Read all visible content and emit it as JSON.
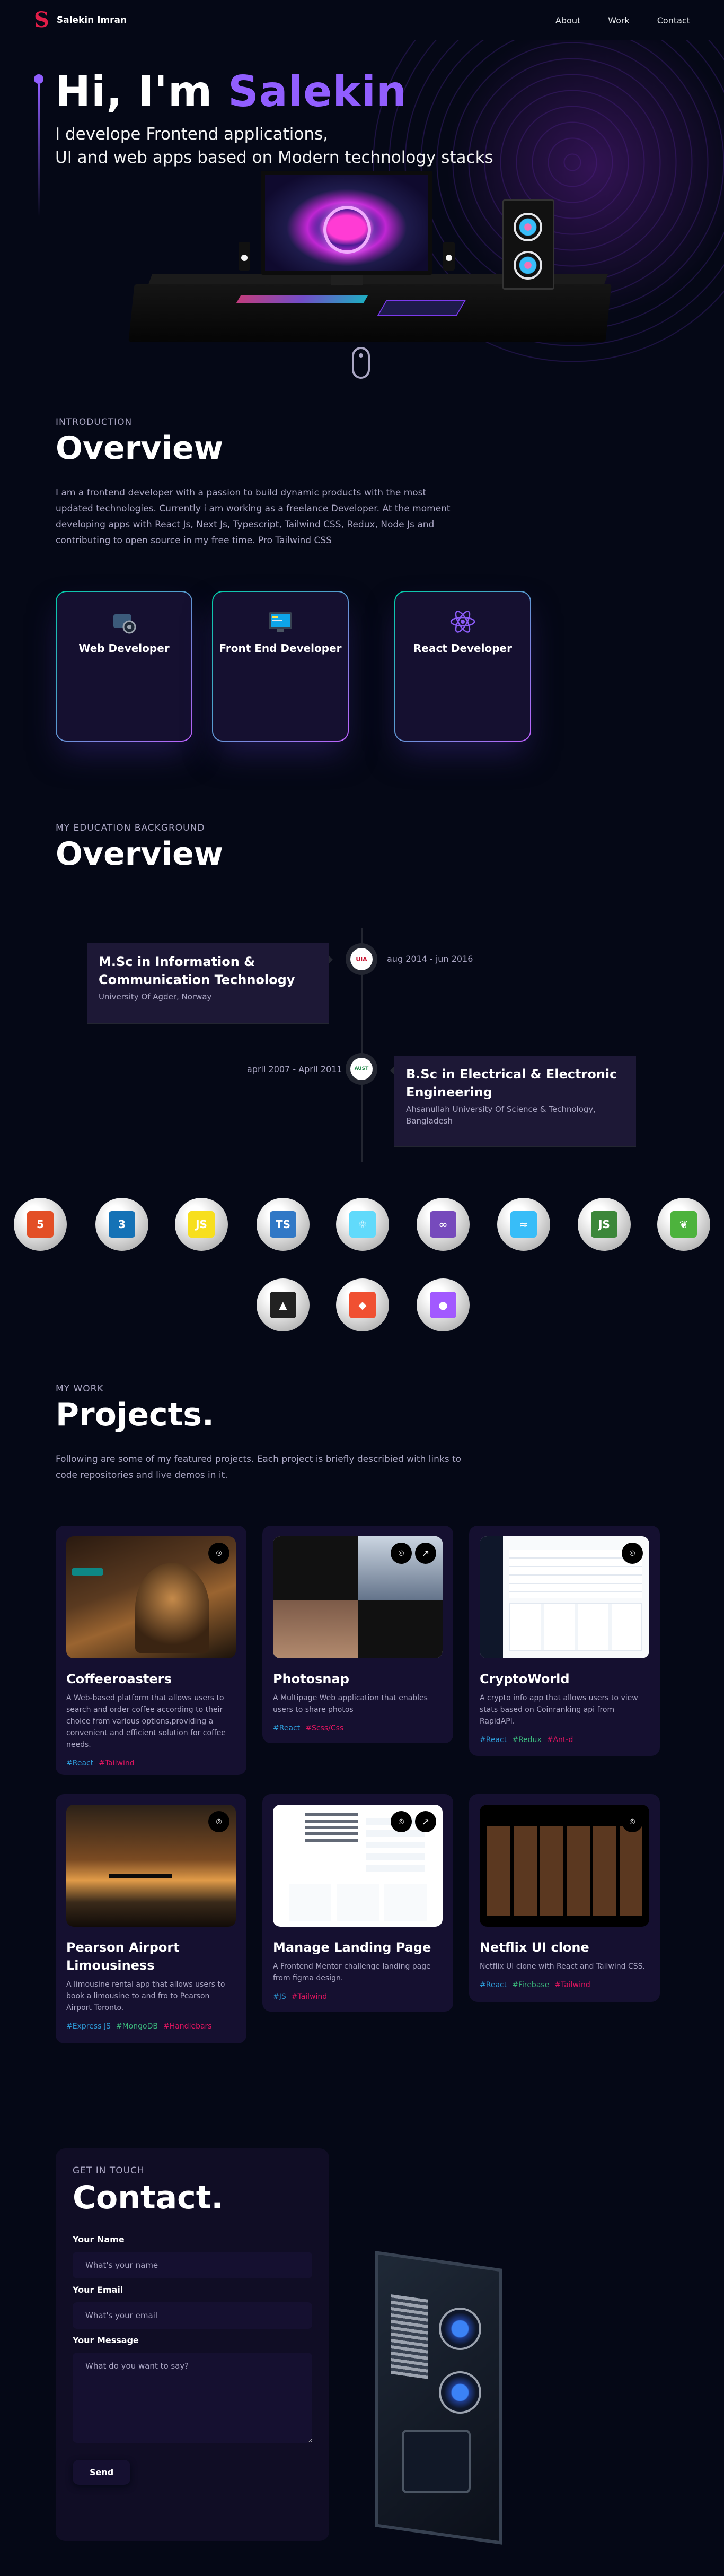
{
  "nav": {
    "logo_text": "Salekin Imran",
    "links": [
      "About",
      "Work",
      "Contact"
    ]
  },
  "hero": {
    "greeting": "Hi, I'm ",
    "name": "Salekin",
    "subtitle_line1": "I develope Frontend applications,",
    "subtitle_line2": "UI and web apps based on Modern technology stacks"
  },
  "about": {
    "subtitle": "Introduction",
    "heading": "Overview",
    "paragraph": "I am a frontend developer with a passion to build dynamic products with the most updated technologies. Currently i am working as a freelance Developer. At the moment developing apps with React Js, Next Js, Typescript, Tailwind CSS, Redux, Node Js and contributing to open source in my free time. Pro Tailwind CSS",
    "services": [
      {
        "title": "Web Developer",
        "icon": "web-dev-icon"
      },
      {
        "title": "Front End Developer",
        "icon": "frontend-icon"
      },
      {
        "title": "React Developer",
        "icon": "react-icon"
      }
    ]
  },
  "education": {
    "subtitle": "My education background",
    "heading": "Overview",
    "items": [
      {
        "degree": "M.Sc in Information & Communication Technology",
        "school": "University Of Agder, Norway",
        "date": "aug 2014 - jun 2016",
        "badge": "UiA"
      },
      {
        "degree": "B.Sc in Electrical & Electronic Engineering",
        "school": "Ahsanullah University Of Science & Technology, Bangladesh",
        "date": "april 2007 - April 2011",
        "badge": "AUST"
      }
    ]
  },
  "tech": [
    {
      "name": "html5-icon",
      "glyph": "5",
      "color": "#e34f26"
    },
    {
      "name": "css3-icon",
      "glyph": "3",
      "color": "#1572b6"
    },
    {
      "name": "javascript-icon",
      "glyph": "JS",
      "color": "#f7df1e"
    },
    {
      "name": "typescript-icon",
      "glyph": "TS",
      "color": "#3178c6"
    },
    {
      "name": "react-icon",
      "glyph": "⚛",
      "color": "#61dafb"
    },
    {
      "name": "redux-icon",
      "glyph": "∞",
      "color": "#764abc"
    },
    {
      "name": "tailwind-icon",
      "glyph": "≈",
      "color": "#38bdf8"
    },
    {
      "name": "nodejs-icon",
      "glyph": "JS",
      "color": "#3c873a"
    },
    {
      "name": "mongodb-icon",
      "glyph": "❦",
      "color": "#4db33d"
    },
    {
      "name": "threejs-icon",
      "glyph": "▲",
      "color": "#222222"
    },
    {
      "name": "git-icon",
      "glyph": "◆",
      "color": "#f05032"
    },
    {
      "name": "figma-icon",
      "glyph": "●",
      "color": "#a259ff"
    }
  ],
  "projects": {
    "subtitle": "My work",
    "heading": "Projects.",
    "intro": "Following are some of my featured projects. Each project is briefly describied with links to code repositories and live demos in it.",
    "items": [
      {
        "title": "Coffeeroasters",
        "description": "A Web-based platform that allows users to search and order coffee according to their choice from various options,providing a convenient and efficient solution for coffee needs.",
        "tags": [
          {
            "text": "#React",
            "color": "#2d9ad6"
          },
          {
            "text": "#Tailwind",
            "color": "#e0155f"
          }
        ]
      },
      {
        "title": "Photosnap",
        "description": "A Multipage Web application that enables users to share photos",
        "tags": [
          {
            "text": "#React",
            "color": "#2d9ad6"
          },
          {
            "text": "#Scss/Css",
            "color": "#e0155f"
          }
        ]
      },
      {
        "title": "CryptoWorld",
        "description": "A crypto info app that allows users to view stats based on Coinranking api from RapidAPI.",
        "tags": [
          {
            "text": "#React",
            "color": "#2d9ad6"
          },
          {
            "text": "#Redux",
            "color": "#3ab67b"
          },
          {
            "text": "#Ant-d",
            "color": "#e0155f"
          }
        ]
      },
      {
        "title": "Pearson Airport Limousiness",
        "description": "A limousine rental app that allows users to book a limousine to and fro to Pearson Airport Toronto.",
        "tags": [
          {
            "text": "#Express JS",
            "color": "#2d9ad6"
          },
          {
            "text": "#MongoDB",
            "color": "#3ab67b"
          },
          {
            "text": "#Handlebars",
            "color": "#e0155f"
          }
        ]
      },
      {
        "title": "Manage Landing Page",
        "description": "A Frontend Mentor challenge landing page from figma design.",
        "tags": [
          {
            "text": "#JS",
            "color": "#2d9ad6"
          },
          {
            "text": "#Tailwind",
            "color": "#e0155f"
          }
        ]
      },
      {
        "title": "Netflix UI clone",
        "description": "Netflix UI clone with React and Tailwind CSS.",
        "tags": [
          {
            "text": "#React",
            "color": "#2d9ad6"
          },
          {
            "text": "#Firebase",
            "color": "#3ab67b"
          },
          {
            "text": "#Tailwind",
            "color": "#e0155f"
          }
        ]
      }
    ]
  },
  "contact": {
    "subtitle": "Get in touch",
    "heading": "Contact.",
    "name_label": "Your Name",
    "name_placeholder": "What's your name",
    "email_label": "Your Email",
    "email_placeholder": "What's your email",
    "message_label": "Your Message",
    "message_placeholder": "What do you want to say?",
    "send_label": "Send"
  }
}
